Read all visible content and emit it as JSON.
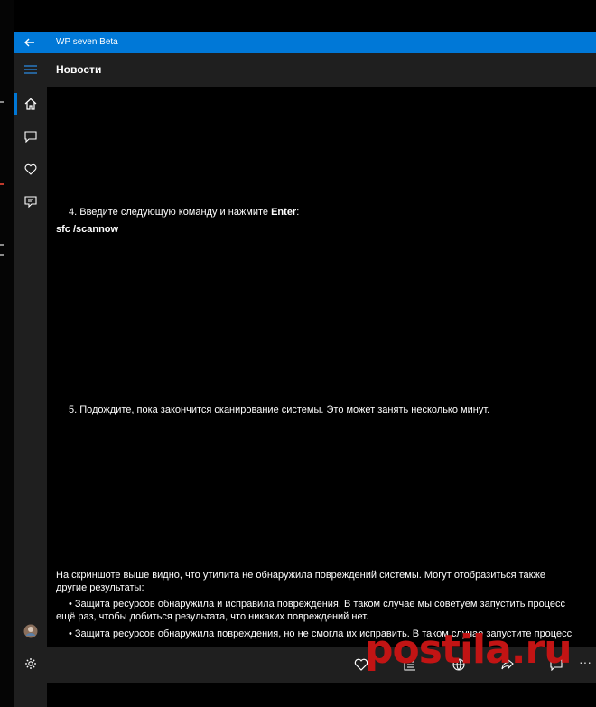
{
  "window": {
    "title": "WP seven Beta"
  },
  "header": {
    "title": "Новости"
  },
  "sidebar": {
    "items": [
      {
        "icon": "home-icon",
        "label": "Главная"
      },
      {
        "icon": "comment-icon",
        "label": "Комментарии"
      },
      {
        "icon": "heart-icon",
        "label": "Избранное"
      },
      {
        "icon": "forum-icon",
        "label": "Форум"
      }
    ],
    "bottom": [
      {
        "icon": "avatar"
      },
      {
        "icon": "gear-icon"
      }
    ]
  },
  "article": {
    "step4_text": "4. Введите следующую команду и нажмите ",
    "step4_bold": "Enter",
    "step4_suffix": ":",
    "command": "sfc /scannow",
    "step5_text": "5. Подождите, пока закончится сканирование системы. Это может занять несколько минут.",
    "para_line1": "На скриншоте выше видно, что утилита не обнаружила повреждений системы. Могут отобразиться также",
    "para_line2": "другие результаты:",
    "bullet1_line1": "• Защита ресурсов обнаружила и исправила повреждения. В таком случае мы советуем запустить процесс",
    "bullet1_line2": "ещё раз, чтобы добиться результата, что никаких повреждений нет.",
    "bullet2_line1": "• Защита ресурсов обнаружила повреждения, но не смогла их исправить. В таком случае запустите процесс"
  },
  "bottombar": {
    "buttons": [
      "heart-icon",
      "list-icon",
      "globe-icon",
      "share-icon",
      "comment-icon"
    ],
    "more": "···"
  },
  "watermark": {
    "text": "postila.ru",
    "color": "#c21414"
  },
  "colors": {
    "accent": "#0078d7",
    "chrome": "#1f1f1f",
    "background": "#000000"
  }
}
